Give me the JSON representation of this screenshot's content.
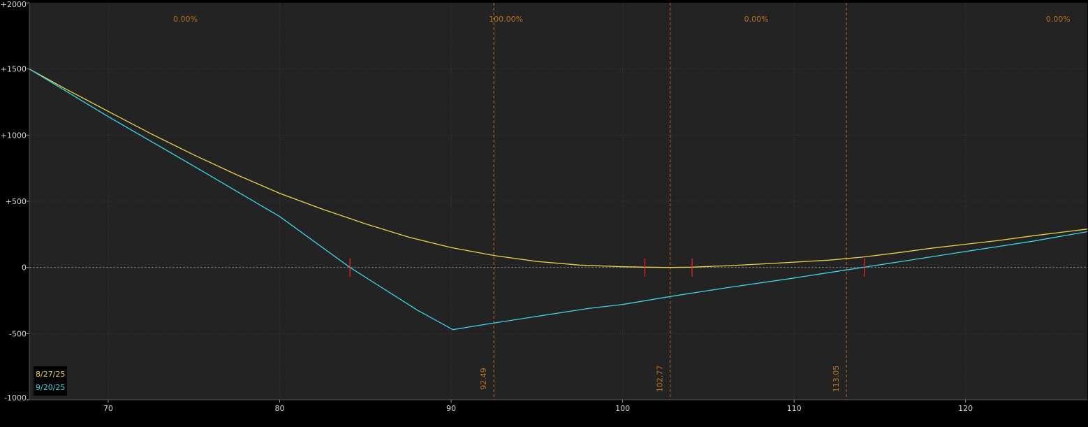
{
  "chart_data": {
    "type": "line",
    "xlim": [
      65.4,
      127.1
    ],
    "ylim": [
      -1000,
      2000
    ],
    "x_ticks": [
      70,
      80,
      90,
      100,
      110,
      120
    ],
    "y_ticks": [
      {
        "value": 2000,
        "label": "+2000"
      },
      {
        "value": 1500,
        "label": "+1500"
      },
      {
        "value": 1000,
        "label": "+1000"
      },
      {
        "value": 500,
        "label": "+500"
      },
      {
        "value": 0,
        "label": "0"
      },
      {
        "value": -500,
        "label": "-500"
      },
      {
        "value": -1000,
        "label": "-1000"
      }
    ],
    "grid": true,
    "legend_position": "bottom-left",
    "series": [
      {
        "name": "8/27/25",
        "color": "#e8d44a",
        "x": [
          65.4,
          67.5,
          70,
          72.5,
          75,
          77.5,
          80,
          82.5,
          85,
          87.5,
          90,
          92.5,
          95,
          97.5,
          100,
          101.3,
          102.77,
          104,
          106,
          108,
          110,
          112,
          114,
          116,
          118,
          120,
          122,
          124,
          127.1
        ],
        "y": [
          1500,
          1350,
          1180,
          1010,
          850,
          700,
          560,
          440,
          330,
          230,
          150,
          90,
          45,
          18,
          5,
          2,
          0,
          2,
          12,
          25,
          40,
          55,
          78,
          110,
          145,
          175,
          205,
          240,
          290
        ]
      },
      {
        "name": "9/20/25",
        "color": "#3dd5e6",
        "x": [
          65.4,
          70,
          75,
          80,
          84.1,
          88,
          90.1,
          92,
          95,
          98,
          100,
          102.77,
          106,
          110,
          112,
          114,
          116,
          118,
          120,
          122,
          124,
          127.1
        ],
        "y": [
          1500,
          1140,
          765,
          385,
          0,
          -320,
          -470,
          -430,
          -370,
          -310,
          -280,
          -220,
          -155,
          -80,
          -40,
          0,
          40,
          80,
          120,
          160,
          200,
          270
        ]
      }
    ],
    "vertical_lines": [
      {
        "x": 92.49,
        "label": "92.49"
      },
      {
        "x": 102.77,
        "label": "102.77"
      },
      {
        "x": 113.05,
        "label": "113.05"
      }
    ],
    "zone_labels": [
      {
        "x": 74.5,
        "label": "0.00%"
      },
      {
        "x": 93.2,
        "label": "100.00%"
      },
      {
        "x": 107.8,
        "label": "0.00%"
      },
      {
        "x": 125.4,
        "label": "0.00%"
      }
    ],
    "breakeven_markers": [
      84.1,
      101.3,
      104.05,
      114.1
    ]
  },
  "colors": {
    "background": "#000000",
    "plot_background": "#232323",
    "grid": "#3a3a3a",
    "zero_line": "#7a7a7a",
    "vertical_line": "#b8721e",
    "marker": "#ff2020"
  }
}
